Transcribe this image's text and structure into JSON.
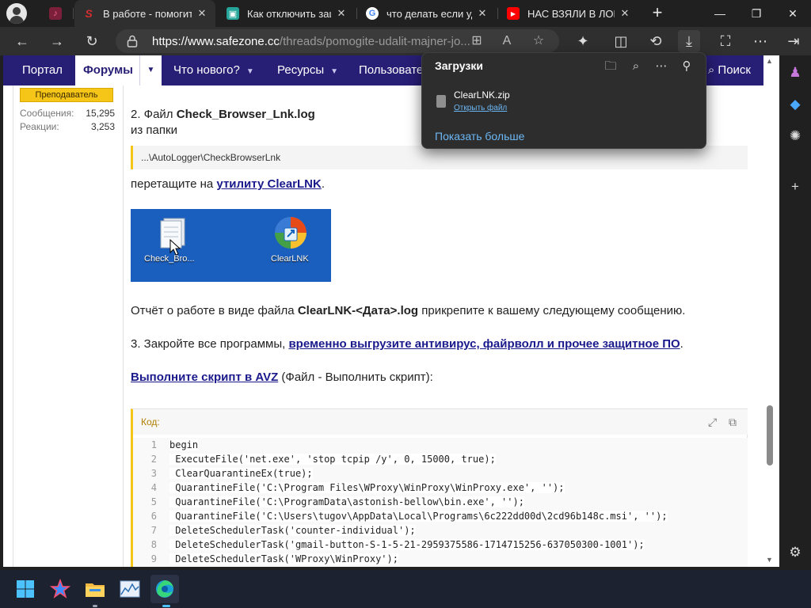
{
  "browser": {
    "tabs": [
      {
        "title": "",
        "favicon_color": "#c2185b",
        "favicon_glyph": "music"
      },
      {
        "title": "В работе - помогите",
        "favicon_color": "#d32f2f",
        "favicon_glyph": "S"
      },
      {
        "title": "Как отключить защи",
        "favicon_color": "#26a69a",
        "favicon_glyph": "image"
      },
      {
        "title": "что делать если уда",
        "favicon_color": "#4285f4",
        "favicon_glyph": "G"
      },
      {
        "title": "НАС ВЗЯЛИ В ЛОВУ",
        "favicon_color": "#ff0000",
        "favicon_glyph": "play"
      }
    ],
    "active_tab": 1,
    "address": {
      "host": "https://www.safezone.cc",
      "path": "/threads/pomogite-udalit-majner-jo..."
    }
  },
  "downloads": {
    "title": "Загрузки",
    "file_name": "ClearLNK.zip",
    "open_link": "Открыть файл",
    "show_more": "Показать больше"
  },
  "nav": {
    "items": [
      "Портал",
      "Форумы",
      "Что нового?",
      "Ресурсы",
      "Пользовате"
    ],
    "search": "Поиск"
  },
  "user": {
    "role": "Преподаватель",
    "messages_label": "Сообщения:",
    "messages_value": "15,295",
    "reactions_label": "Реакции:",
    "reactions_value": "3,253"
  },
  "post": {
    "step2_prefix": "2. Файл ",
    "step2_file": "Check_Browser_Lnk.log",
    "from_folder": "из папки",
    "folder_path": "...\\AutoLogger\\CheckBrowserLnk",
    "drag_prefix": "перетащите на ",
    "drag_link": "утилиту ClearLNK",
    "drag_suffix": ".",
    "img_label_left": "Check_Bro...",
    "img_label_right": "ClearLNK",
    "report_prefix": "Отчёт о работе в виде файла ",
    "report_file": "ClearLNK-<Дата>.log",
    "report_suffix": " прикрепите к вашему следующему сообщению.",
    "step3_prefix": "3. Закройте все программы, ",
    "step3_link": "временно выгрузите антивирус, файрволл и прочее защитное ПО",
    "step3_suffix": ".",
    "avz_link": "Выполните скрипт в AVZ",
    "avz_suffix": " (Файл - Выполнить скрипт):",
    "code_label": "Код:",
    "code_lines": [
      "begin",
      " ExecuteFile('net.exe', 'stop tcpip /y', 0, 15000, true);",
      " ClearQuarantineEx(true);",
      " QuarantineFile('C:\\Program Files\\WProxy\\WinProxy\\WinProxy.exe', '');",
      " QuarantineFile('C:\\ProgramData\\astonish-bellow\\bin.exe', '');",
      " QuarantineFile('C:\\Users\\tugov\\AppData\\Local\\Programs\\6c222dd00d\\2cd96b148c.msi', '');",
      " DeleteSchedulerTask('counter-individual');",
      " DeleteSchedulerTask('gmail-button-S-1-5-21-2959375586-1714715256-637050300-1001');",
      " DeleteSchedulerTask('WProxy\\WinProxy');"
    ],
    "line_numbers": [
      "1",
      "2",
      "3",
      "4",
      "5",
      "6",
      "7",
      "8",
      "9"
    ]
  },
  "colors": {
    "nav_bg": "#271e75",
    "accent_yellow": "#f5c518",
    "link": "#1a1a8c",
    "downloads_link": "#6cb8f6"
  }
}
